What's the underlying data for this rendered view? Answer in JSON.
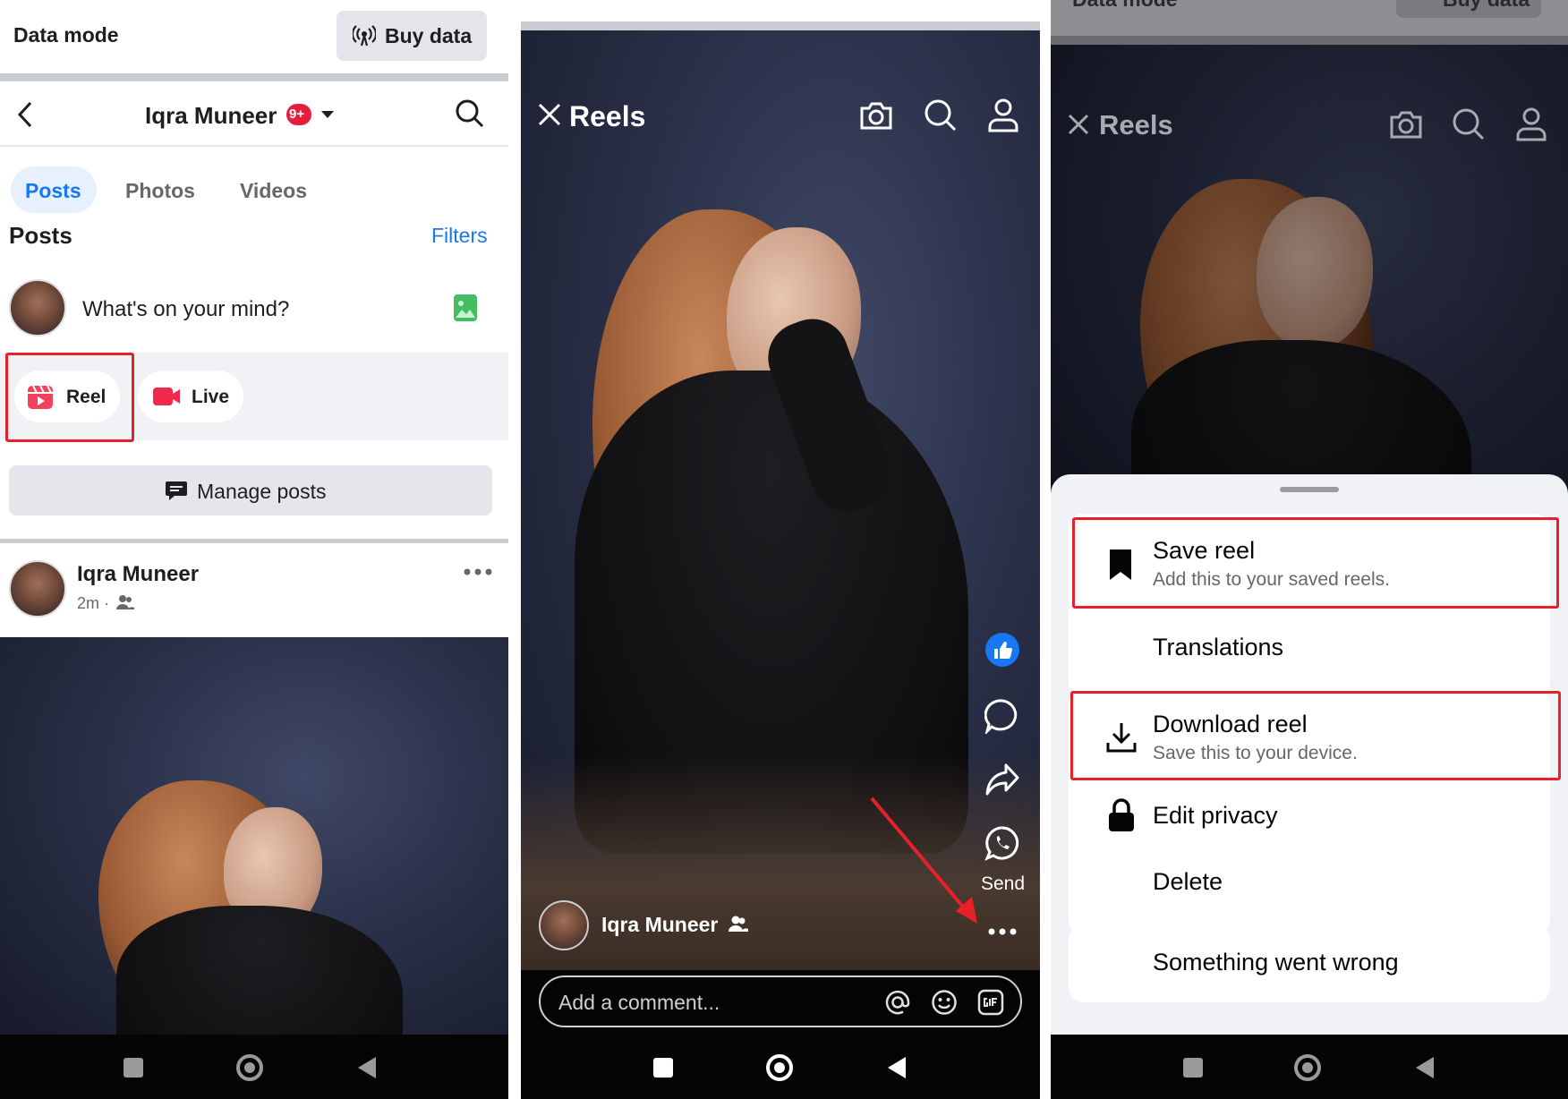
{
  "panel1": {
    "data_mode": "Data mode",
    "buy_data": "Buy data",
    "profile_name": "Iqra Muneer",
    "notif_badge": "9+",
    "tabs": [
      "Posts",
      "Photos",
      "Videos"
    ],
    "section_title": "Posts",
    "filters": "Filters",
    "composer_placeholder": "What's on your mind?",
    "reel_chip": "Reel",
    "live_chip": "Live",
    "manage_posts": "Manage posts",
    "post_author": "Iqra Muneer",
    "post_time": "2m ·"
  },
  "panel2": {
    "title": "Reels",
    "send_label": "Send",
    "author": "Iqra Muneer",
    "comment_placeholder": "Add a comment..."
  },
  "panel3": {
    "title": "Reels",
    "data_mode": "Data mode",
    "buy_data": "Buy data",
    "menu": {
      "save_title": "Save reel",
      "save_sub": "Add this to your saved reels.",
      "translations": "Translations",
      "download_title": "Download reel",
      "download_sub": "Save this to your device.",
      "edit_privacy": "Edit privacy",
      "delete": "Delete",
      "error": "Something went wrong"
    }
  },
  "colors": {
    "accent": "#1877f2",
    "highlight": "#e8202a",
    "badge": "#e41e3f"
  },
  "icons": [
    "back-arrow-icon",
    "search-icon",
    "camera-icon",
    "profile-icon",
    "close-icon",
    "like-icon",
    "comment-icon",
    "share-icon",
    "whatsapp-icon",
    "more-icon",
    "bookmark-icon",
    "download-icon",
    "lock-icon",
    "at-icon",
    "emoji-icon",
    "gif-icon",
    "image-icon",
    "reel-icon",
    "live-icon",
    "friends-icon"
  ]
}
